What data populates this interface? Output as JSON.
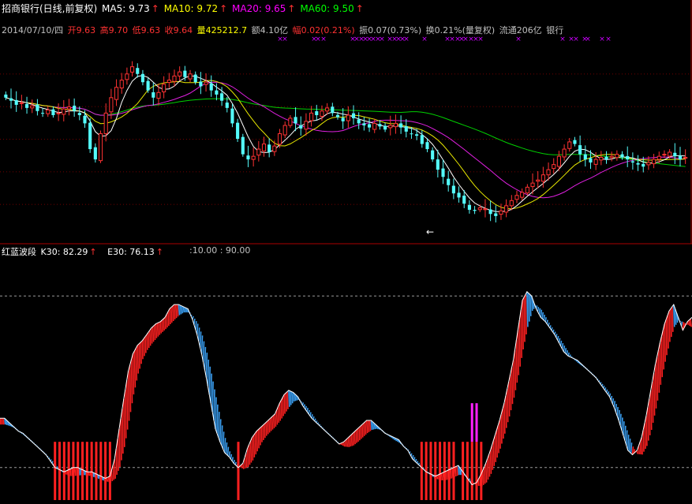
{
  "header": {
    "title": "招商银行(日线,前复权)",
    "ma5": {
      "label": "MA5: 9.73",
      "color": "#ffffff"
    },
    "ma10": {
      "label": "MA10: 9.72",
      "color": "#ffff00"
    },
    "ma20": {
      "label": "MA20: 9.65",
      "color": "#ff00ff"
    },
    "ma60": {
      "label": "MA60: 9.50",
      "color": "#00ff00"
    },
    "arrow": "↑"
  },
  "info": {
    "date": "2014/07/10/四",
    "open": "开9.63",
    "high": "高9.70",
    "low": "低9.63",
    "close": "收9.64",
    "volume": "量425212.7",
    "amount": "额4.10亿",
    "change": "幅0.02(0.21%)",
    "amplitude": "振0.07(0.73%)",
    "turnover": "换0.21%(量复权)",
    "float_cap": "流通206亿",
    "sector": "银行"
  },
  "indicator": {
    "name": "红蓝波段",
    "k30": "K30: 82.29",
    "e30": "E30: 76.13",
    "range": ":10.00 : 90.00",
    "arrow": "↑"
  },
  "colors": {
    "background": "#000000",
    "up": "#ff3232",
    "down": "#54fcfc",
    "red_band": "#ff2020",
    "blue_band": "#3a9ff2",
    "signal_magenta": "#ff20ff",
    "marker": "#cc00ff",
    "divider": "#aa0000",
    "reference_line": "#9a9a9a"
  },
  "chart_data": [
    {
      "type": "candlestick",
      "name": "price",
      "ylim": [
        8.2,
        10.1
      ],
      "values": [
        9.55,
        9.52,
        9.48,
        9.5,
        9.45,
        9.47,
        9.42,
        9.4,
        9.43,
        9.38,
        9.4,
        9.44,
        9.46,
        9.42,
        9.38,
        9.3,
        9.05,
        8.95,
        9.2,
        9.4,
        9.55,
        9.65,
        9.72,
        9.78,
        9.85,
        9.78,
        9.7,
        9.62,
        9.55,
        9.6,
        9.68,
        9.72,
        9.76,
        9.8,
        9.75,
        9.78,
        9.7,
        9.66,
        9.7,
        9.62,
        9.58,
        9.52,
        9.45,
        9.3,
        9.15,
        9.0,
        8.95,
        8.98,
        9.05,
        9.1,
        9.02,
        9.08,
        9.2,
        9.28,
        9.35,
        9.3,
        9.25,
        9.32,
        9.4,
        9.38,
        9.42,
        9.45,
        9.4,
        9.36,
        9.32,
        9.38,
        9.35,
        9.3,
        9.28,
        9.26,
        9.3,
        9.27,
        9.24,
        9.28,
        9.3,
        9.26,
        9.22,
        9.2,
        9.18,
        9.1,
        9.05,
        8.95,
        8.85,
        8.78,
        8.7,
        8.62,
        8.58,
        8.52,
        8.46,
        8.45,
        8.48,
        8.47,
        8.42,
        8.4,
        8.45,
        8.5,
        8.55,
        8.6,
        8.63,
        8.68,
        8.72,
        8.75,
        8.8,
        8.85,
        8.9,
        8.98,
        9.05,
        9.12,
        9.1,
        9.0,
        8.95,
        8.92,
        8.95,
        8.97,
        8.95,
        8.98,
        9.0,
        8.97,
        8.95,
        8.92,
        8.9,
        8.88,
        8.92,
        8.95,
        8.98,
        9.0,
        9.02,
        8.98,
        8.95,
        8.97
      ],
      "marker_x": [
        355,
        361,
        398,
        403,
        410,
        447,
        452,
        458,
        463,
        468,
        473,
        479,
        484,
        494,
        500,
        505,
        510,
        515,
        538,
        567,
        573,
        580,
        585,
        590,
        597,
        603,
        609,
        657,
        713,
        724,
        730,
        741,
        745,
        763,
        771
      ]
    },
    {
      "type": "line",
      "name": "wave",
      "ylim": [
        0,
        100
      ],
      "reference_lines": [
        10,
        90
      ],
      "values": [
        33,
        33,
        31,
        29,
        27,
        26,
        24,
        22,
        20,
        18,
        16,
        13,
        10,
        9,
        8,
        9,
        10,
        10,
        9,
        8,
        8,
        7,
        6,
        5,
        6,
        14,
        28,
        42,
        55,
        63,
        67,
        69,
        72,
        75,
        77,
        78,
        80,
        84,
        86,
        86,
        85,
        84,
        79,
        72,
        63,
        52,
        40,
        28,
        22,
        17,
        15,
        12,
        10,
        12,
        19,
        24,
        27,
        29,
        31,
        33,
        35,
        40,
        44,
        46,
        45,
        43,
        39,
        36,
        33,
        31,
        29,
        27,
        25,
        23,
        21,
        22,
        24,
        26,
        28,
        30,
        32,
        32,
        30,
        28,
        26,
        25,
        24,
        23,
        20,
        18,
        14,
        12,
        10,
        8,
        7,
        6,
        7,
        8,
        9,
        10,
        11,
        8,
        5,
        2,
        3,
        7,
        12,
        18,
        25,
        32,
        40,
        50,
        60,
        74,
        88,
        92,
        90,
        84,
        80,
        78,
        75,
        72,
        68,
        64,
        62,
        61,
        60,
        58,
        56,
        54,
        52,
        49,
        46,
        43,
        38,
        32,
        25,
        18,
        16,
        18,
        24,
        34,
        46,
        58,
        68,
        77,
        83,
        86,
        80,
        74,
        78,
        80
      ]
    }
  ]
}
